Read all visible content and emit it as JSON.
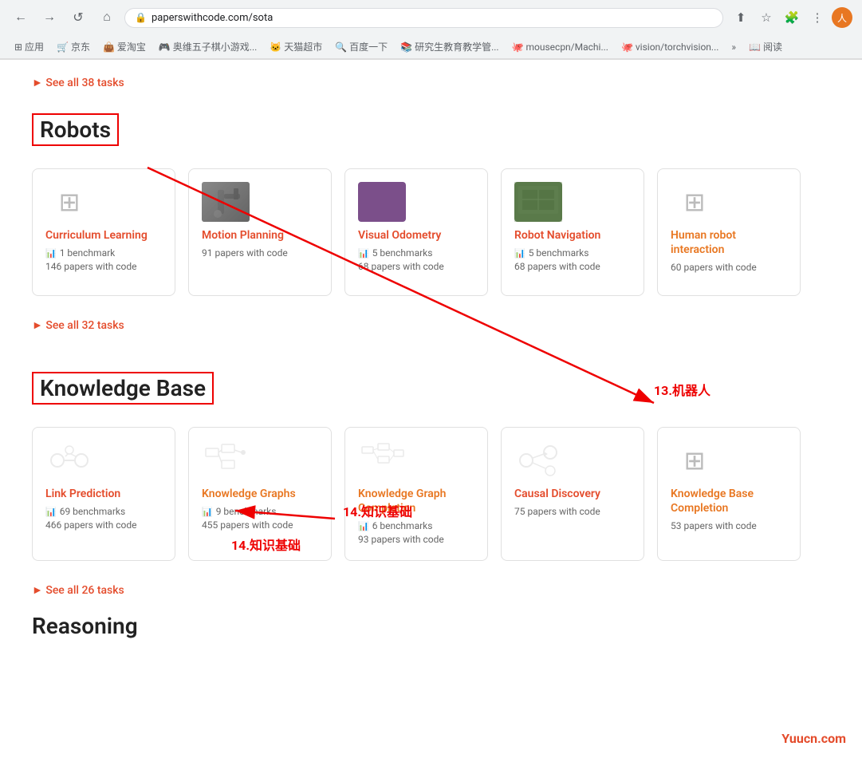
{
  "browser": {
    "url": "paperswithcode.com/sota",
    "back": "←",
    "forward": "→",
    "refresh": "↺",
    "home": "⌂",
    "bookmarks": [
      {
        "label": "应用",
        "icon": "⊞"
      },
      {
        "label": "京东",
        "icon": ""
      },
      {
        "label": "爱淘宝",
        "icon": ""
      },
      {
        "label": "奥维五子棋小游戏...",
        "icon": ""
      },
      {
        "label": "天猫超市",
        "icon": ""
      },
      {
        "label": "百度一下",
        "icon": ""
      },
      {
        "label": "研究生教育教学管...",
        "icon": ""
      },
      {
        "label": "mousecpn/Machi...",
        "icon": ""
      },
      {
        "label": "vision/torchvision...",
        "icon": ""
      },
      {
        "label": "»",
        "icon": ""
      },
      {
        "label": "阅读",
        "icon": ""
      }
    ]
  },
  "sections": {
    "robots": {
      "see_all_top": "► See all 38 tasks",
      "heading": "Robots",
      "cards": [
        {
          "title": "Curriculum Learning",
          "has_thumbnail": false,
          "benchmarks": "1 benchmark",
          "papers": "146 papers with code"
        },
        {
          "title": "Motion Planning",
          "has_thumbnail": true,
          "thumb_type": "arm",
          "benchmarks": null,
          "papers": "91 papers with code"
        },
        {
          "title": "Visual Odometry",
          "has_thumbnail": true,
          "thumb_type": "purple",
          "benchmarks": "5 benchmarks",
          "papers": "68 papers with code"
        },
        {
          "title": "Robot Navigation",
          "has_thumbnail": true,
          "thumb_type": "green",
          "benchmarks": "5 benchmarks",
          "papers": "68 papers with code"
        },
        {
          "title": "Human robot interaction",
          "has_thumbnail": false,
          "benchmarks": null,
          "papers": "60 papers with code",
          "title_color": "orange"
        }
      ],
      "see_all_bottom": "► See all 32 tasks"
    },
    "knowledge_base": {
      "heading": "Knowledge Base",
      "cards": [
        {
          "title": "Link Prediction",
          "has_thumbnail": true,
          "thumb_type": "link_pred",
          "benchmarks": "69 benchmarks",
          "papers": "466 papers with code"
        },
        {
          "title": "Knowledge Graphs",
          "has_thumbnail": false,
          "thumb_type": "kg",
          "benchmarks": "9 benchmarks",
          "papers": "455 papers with code",
          "title_color": "orange"
        },
        {
          "title": "Knowledge Graph Completion",
          "has_thumbnail": false,
          "thumb_type": "kgc",
          "benchmarks": "6 benchmarks",
          "papers": "93 papers with code",
          "title_color": "orange"
        },
        {
          "title": "Causal Discovery",
          "has_thumbnail": true,
          "thumb_type": "causal",
          "benchmarks": null,
          "papers": "75 papers with code"
        },
        {
          "title": "Knowledge Base Completion",
          "has_thumbnail": false,
          "thumb_type": "kbc",
          "benchmarks": null,
          "papers": "53 papers with code",
          "title_color": "orange"
        }
      ],
      "see_all_bottom": "► See all 26 tasks"
    },
    "reasoning": {
      "heading": "Reasoning"
    }
  },
  "annotations": {
    "label_14": "14.知识基础",
    "label_13": "13.机器人"
  },
  "watermark": "Yuucn.com"
}
